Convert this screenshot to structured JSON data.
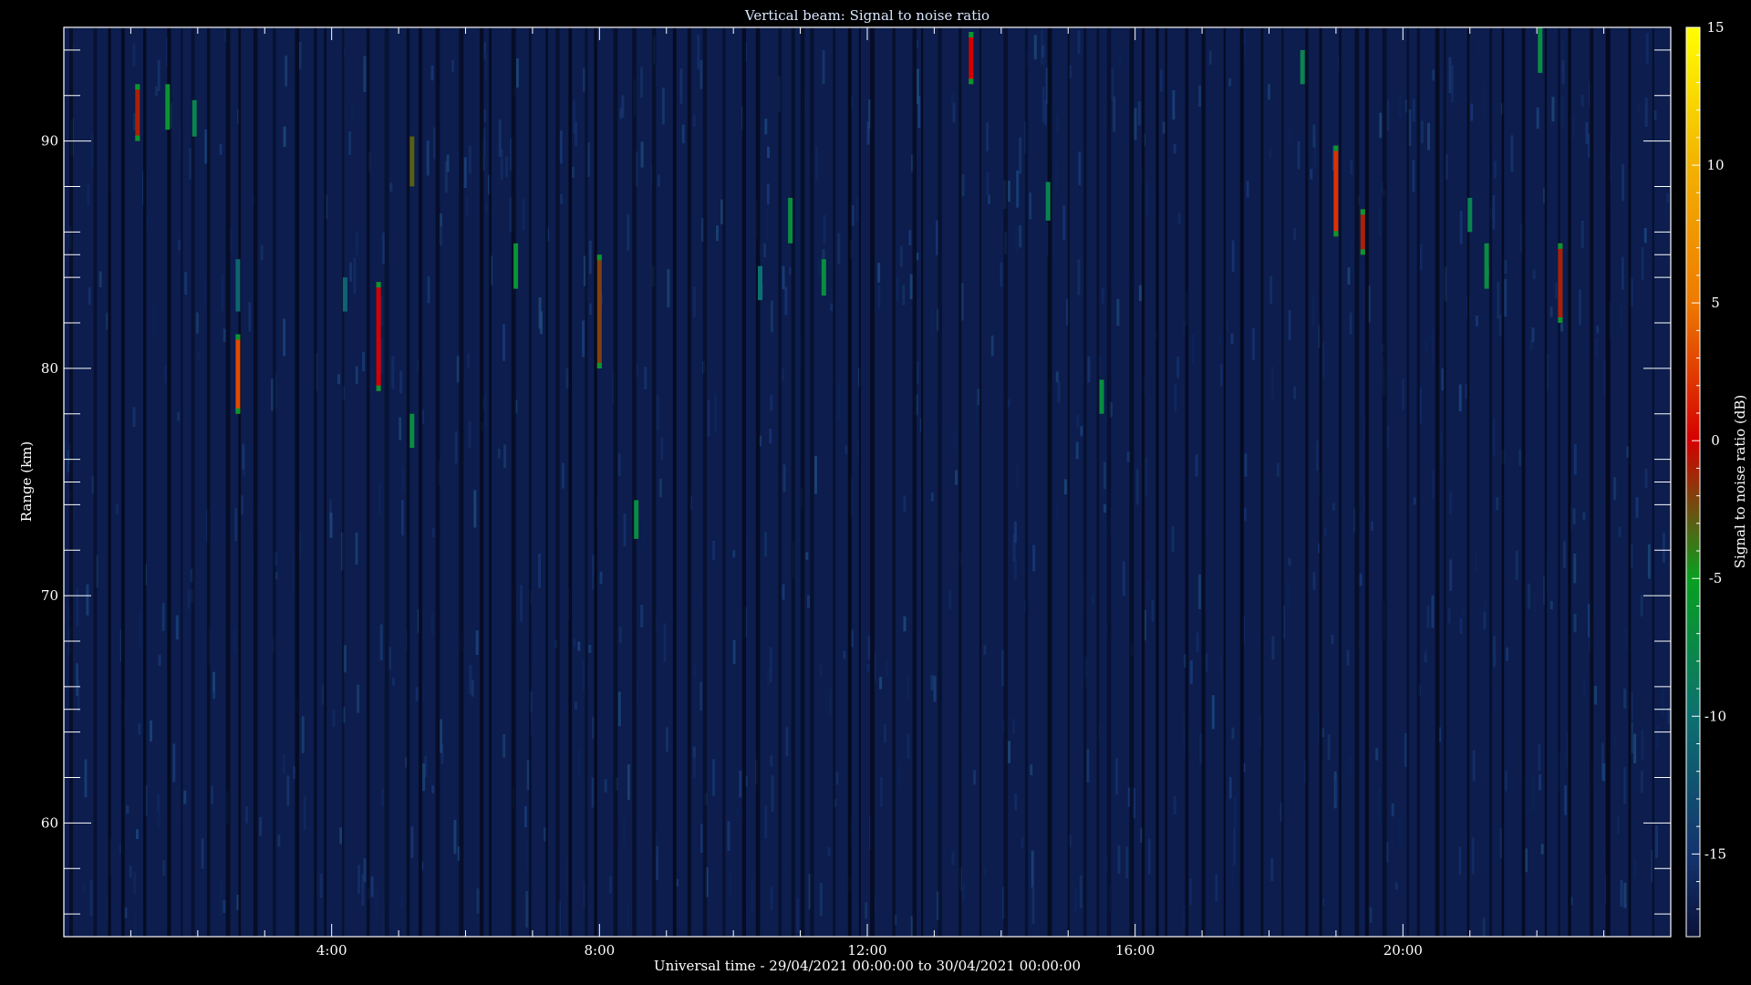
{
  "chart_data": {
    "type": "heatmap",
    "title": "Vertical beam: Signal to noise ratio",
    "xlabel": "Universal time - 29/04/2021 00:00:00 to 30/04/2021 00:00:00",
    "ylabel": "Range (km)",
    "colorbar_label": "Signal to noise ratio (dB)",
    "x_unit": "hours UT",
    "xlim": [
      0,
      24
    ],
    "ylim": [
      55,
      95
    ],
    "zlim": [
      -18,
      15
    ],
    "x_ticks": [
      {
        "value": 4,
        "label": "4:00"
      },
      {
        "value": 8,
        "label": "8:00"
      },
      {
        "value": 12,
        "label": "12:00"
      },
      {
        "value": 16,
        "label": "16:00"
      },
      {
        "value": 20,
        "label": "20:00"
      }
    ],
    "y_ticks": [
      {
        "value": 60,
        "label": "60"
      },
      {
        "value": 70,
        "label": "70"
      },
      {
        "value": 80,
        "label": "80"
      },
      {
        "value": 90,
        "label": "90"
      }
    ],
    "colorbar_ticks": [
      {
        "value": 15,
        "label": "15"
      },
      {
        "value": 10,
        "label": "10"
      },
      {
        "value": 5,
        "label": "5"
      },
      {
        "value": 0,
        "label": "0"
      },
      {
        "value": -5,
        "label": "-5"
      },
      {
        "value": -10,
        "label": "-10"
      },
      {
        "value": -15,
        "label": "-15"
      }
    ],
    "background_snr_db": -16,
    "colormap": [
      {
        "value": -18,
        "color": "#0a1138"
      },
      {
        "value": -15,
        "color": "#14346e"
      },
      {
        "value": -10,
        "color": "#0d7070"
      },
      {
        "value": -5,
        "color": "#08a020"
      },
      {
        "value": 0,
        "color": "#d40000"
      },
      {
        "value": 5,
        "color": "#ee7a00"
      },
      {
        "value": 10,
        "color": "#f2b200"
      },
      {
        "value": 15,
        "color": "#ffff00"
      }
    ],
    "echoes": [
      {
        "time": 1.1,
        "range_min": 90.0,
        "range_max": 92.5,
        "snr_db": -1
      },
      {
        "time": 1.55,
        "range_min": 90.5,
        "range_max": 92.5,
        "snr_db": -6
      },
      {
        "time": 1.95,
        "range_min": 90.2,
        "range_max": 91.8,
        "snr_db": -8
      },
      {
        "time": 2.6,
        "range_min": 78.0,
        "range_max": 81.5,
        "snr_db": 3
      },
      {
        "time": 2.6,
        "range_min": 82.5,
        "range_max": 84.8,
        "snr_db": -11
      },
      {
        "time": 4.2,
        "range_min": 82.5,
        "range_max": 84.0,
        "snr_db": -11
      },
      {
        "time": 4.7,
        "range_min": 79.0,
        "range_max": 83.8,
        "snr_db": 0
      },
      {
        "time": 5.2,
        "range_min": 88.0,
        "range_max": 90.2,
        "snr_db": -3
      },
      {
        "time": 5.2,
        "range_min": 76.5,
        "range_max": 78.0,
        "snr_db": -7
      },
      {
        "time": 6.75,
        "range_min": 83.5,
        "range_max": 85.5,
        "snr_db": -6
      },
      {
        "time": 8.0,
        "range_min": 80.0,
        "range_max": 85.0,
        "snr_db": -2
      },
      {
        "time": 8.55,
        "range_min": 72.5,
        "range_max": 74.2,
        "snr_db": -7
      },
      {
        "time": 10.4,
        "range_min": 83.0,
        "range_max": 84.5,
        "snr_db": -10
      },
      {
        "time": 10.85,
        "range_min": 85.5,
        "range_max": 87.5,
        "snr_db": -7
      },
      {
        "time": 11.35,
        "range_min": 83.2,
        "range_max": 84.8,
        "snr_db": -7
      },
      {
        "time": 13.55,
        "range_min": 92.5,
        "range_max": 94.8,
        "snr_db": 0
      },
      {
        "time": 14.7,
        "range_min": 86.5,
        "range_max": 88.2,
        "snr_db": -8
      },
      {
        "time": 15.5,
        "range_min": 78.0,
        "range_max": 79.5,
        "snr_db": -7
      },
      {
        "time": 18.5,
        "range_min": 92.5,
        "range_max": 94.0,
        "snr_db": -8
      },
      {
        "time": 19.0,
        "range_min": 85.8,
        "range_max": 89.8,
        "snr_db": 2
      },
      {
        "time": 19.4,
        "range_min": 85.0,
        "range_max": 87.0,
        "snr_db": -1
      },
      {
        "time": 21.0,
        "range_min": 86.0,
        "range_max": 87.5,
        "snr_db": -8
      },
      {
        "time": 21.25,
        "range_min": 83.5,
        "range_max": 85.5,
        "snr_db": -7
      },
      {
        "time": 22.05,
        "range_min": 93.0,
        "range_max": 95.0,
        "snr_db": -7
      },
      {
        "time": 22.35,
        "range_min": 82.0,
        "range_max": 85.5,
        "snr_db": -1
      }
    ]
  }
}
